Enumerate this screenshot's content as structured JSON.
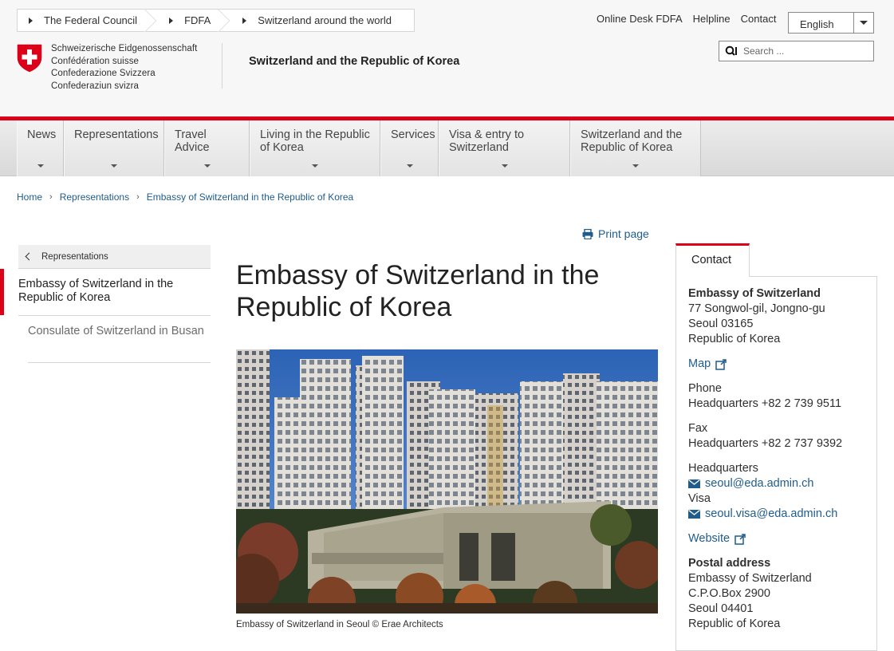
{
  "top_breadcrumb": [
    "The Federal Council",
    "FDFA",
    "Switzerland around the world"
  ],
  "top_links": [
    "Online Desk FDFA",
    "Helpline",
    "Contact"
  ],
  "language": {
    "selected": "English"
  },
  "search": {
    "placeholder": "Search ..."
  },
  "federation_names": [
    "Schweizerische Eidgenossenschaft",
    "Confédération suisse",
    "Confederazione Svizzera",
    "Confederaziun svizra"
  ],
  "site_title": "Switzerland and the Republic of Korea",
  "main_nav": [
    "News",
    "Representations",
    "Travel Advice",
    "Living in the Republic of Korea",
    "Services",
    "Visa & entry to Switzerland",
    "Switzerland and the Republic of Korea"
  ],
  "breadcrumb": [
    "Home",
    "Representations",
    "Embassy of Switzerland in the Republic of Korea"
  ],
  "subnav": {
    "back_label": "Representations",
    "active": "Embassy of Switzerland in the Republic of Korea",
    "items": [
      "Consulate of Switzerland in Busan"
    ]
  },
  "print_label": "Print page",
  "page_title": "Embassy of Switzerland in the Republic of Korea",
  "photo_caption": "Embassy of Switzerland in Seoul © Erae Architects",
  "contact": {
    "tab_label": "Contact",
    "name": "Embassy of Switzerland",
    "address": [
      "77 Songwol-gil, Jongno-gu",
      "Seoul 03165",
      "Republic of Korea"
    ],
    "map_label": "Map",
    "phone_label": "Phone",
    "phone_value": "Headquarters +82 2 739 9511",
    "fax_label": "Fax",
    "fax_value": "Headquarters +82 2 737 9392",
    "hq_label": "Headquarters",
    "hq_email": "seoul@eda.admin.ch",
    "visa_label": "Visa",
    "visa_email": "seoul.visa@eda.admin.ch",
    "website_label": "Website",
    "postal_label": "Postal address",
    "postal": [
      "Embassy of Switzerland",
      "C.P.O.Box 2900",
      "Seoul 04401",
      "Republic of Korea"
    ]
  },
  "colors": {
    "accent_red": "#dc0018",
    "link_blue": "#1f5c8c"
  }
}
